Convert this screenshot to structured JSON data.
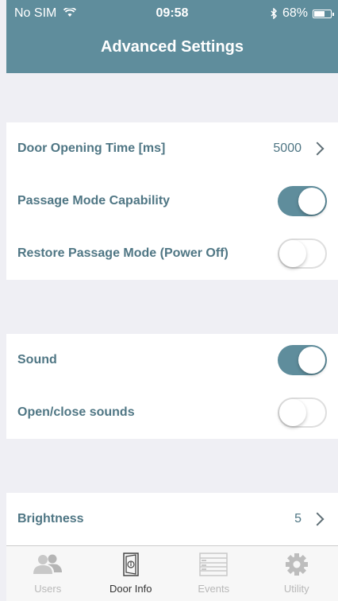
{
  "status_bar": {
    "carrier": "No SIM",
    "time": "09:58",
    "battery_text": "68%",
    "battery_level": 0.68
  },
  "header": {
    "title": "Advanced Settings"
  },
  "settings": {
    "door_opening_time": {
      "label": "Door Opening Time [ms]",
      "value": "5000"
    },
    "passage_mode_capability": {
      "label": "Passage Mode Capability",
      "enabled": true
    },
    "restore_passage_mode": {
      "label": "Restore Passage Mode (Power Off)",
      "enabled": false
    },
    "sound": {
      "label": "Sound",
      "enabled": true
    },
    "open_close_sounds": {
      "label": "Open/close sounds",
      "enabled": false
    },
    "brightness": {
      "label": "Brightness",
      "value": "5"
    }
  },
  "tabbar": {
    "tabs": [
      {
        "label": "Users",
        "icon": "users-icon",
        "active": false
      },
      {
        "label": "Door Info",
        "icon": "door-info-icon",
        "active": true
      },
      {
        "label": "Events",
        "icon": "events-icon",
        "active": false
      },
      {
        "label": "Utility",
        "icon": "gear-icon",
        "active": false
      }
    ]
  },
  "colors": {
    "accent": "#5f8d9c",
    "label_text": "#4f7684",
    "background": "#efeff4"
  }
}
